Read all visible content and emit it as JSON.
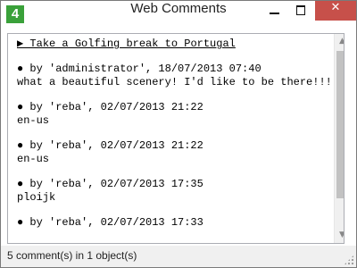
{
  "window": {
    "title": "Web Comments",
    "app_icon_text": "4",
    "close_glyph": "✕"
  },
  "content": {
    "subject": "▶ Take a Golfing break to Portugal",
    "comments": [
      {
        "header": "● by 'administrator', 18/07/2013 07:40",
        "body": "what a beautiful scenery! I'd like to be there!!!"
      },
      {
        "header": "● by 'reba', 02/07/2013 21:22",
        "body": "en-us"
      },
      {
        "header": "● by 'reba', 02/07/2013 21:22",
        "body": "en-us"
      },
      {
        "header": "● by 'reba', 02/07/2013 17:35",
        "body": "ploijk"
      },
      {
        "header": "● by 'reba', 02/07/2013 17:33",
        "body": ""
      }
    ]
  },
  "scroll": {
    "up_glyph": "▲",
    "down_glyph": "▼"
  },
  "status": {
    "text": "5 comment(s) in 1 object(s)"
  }
}
